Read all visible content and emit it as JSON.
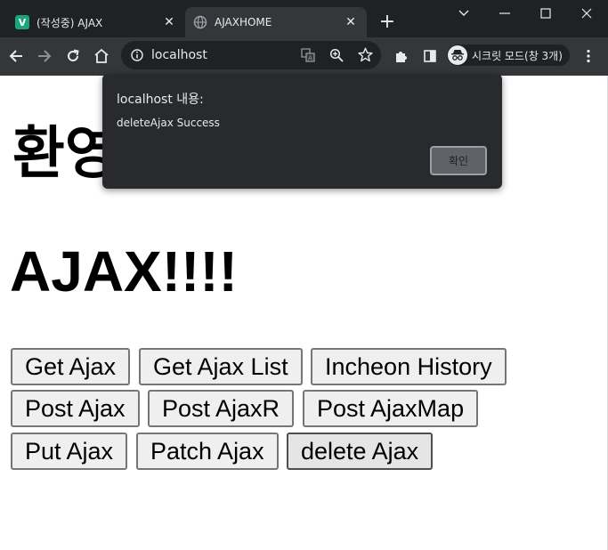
{
  "browser": {
    "tabs": [
      {
        "title": "(작성중) AJAX",
        "favicon": "V",
        "active": false
      },
      {
        "title": "AJAXHOME",
        "active": true
      }
    ],
    "url": "localhost",
    "profile_label": "시크릿 모드(창 3개)"
  },
  "page": {
    "heading_welcome": "환영",
    "heading_ajax": "AJAX!!!!",
    "buttons": [
      "Get Ajax",
      "Get Ajax List",
      "Incheon History",
      "Post Ajax",
      "Post AjaxR",
      "Post AjaxMap",
      "Put Ajax",
      "Patch Ajax",
      "delete Ajax"
    ]
  },
  "dialog": {
    "title": "localhost 내용:",
    "message": "deleteAjax Success",
    "ok_label": "확인"
  },
  "colors": {
    "titlebar": "#202124",
    "toolbar": "#35363a",
    "favicon_green": "#1da57a",
    "dialog_bg": "#292a2d"
  }
}
